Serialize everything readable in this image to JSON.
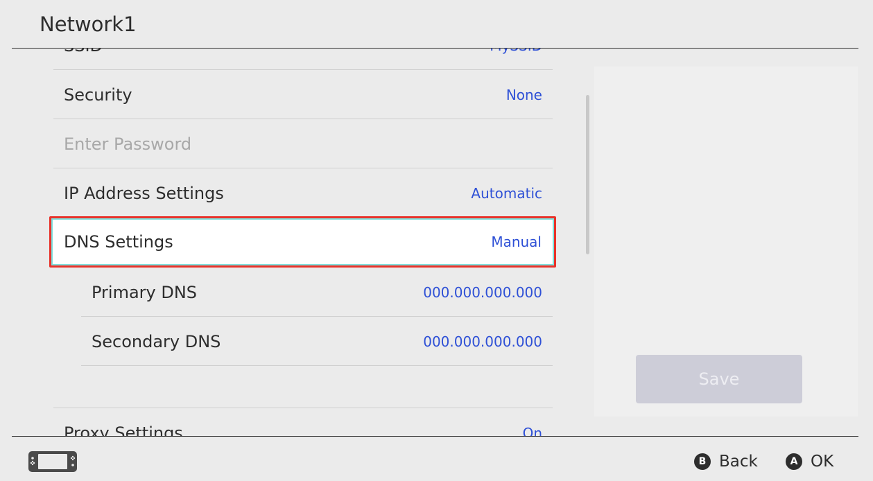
{
  "header": {
    "title": "Network1"
  },
  "settings": {
    "ssid": {
      "label": "SSID",
      "value": "MySSID"
    },
    "security": {
      "label": "Security",
      "value": "None"
    },
    "password": {
      "label": "Enter Password"
    },
    "ip": {
      "label": "IP Address Settings",
      "value": "Automatic"
    },
    "dns": {
      "label": "DNS Settings",
      "value": "Manual"
    },
    "primary_dns": {
      "label": "Primary DNS",
      "value": "000.000.000.000"
    },
    "secondary_dns": {
      "label": "Secondary DNS",
      "value": "000.000.000.000"
    },
    "proxy": {
      "label": "Proxy Settings",
      "value": "On"
    }
  },
  "side_panel": {
    "save_label": "Save"
  },
  "footer": {
    "controller_icon": "handheld-console-icon",
    "back": {
      "button": "B",
      "label": "Back"
    },
    "ok": {
      "button": "A",
      "label": "OK"
    }
  },
  "colors": {
    "value_text": "#2e50d6",
    "selection_border": "#e8322a",
    "selection_glow": "#7fe0dc",
    "background": "#ebebeb"
  }
}
